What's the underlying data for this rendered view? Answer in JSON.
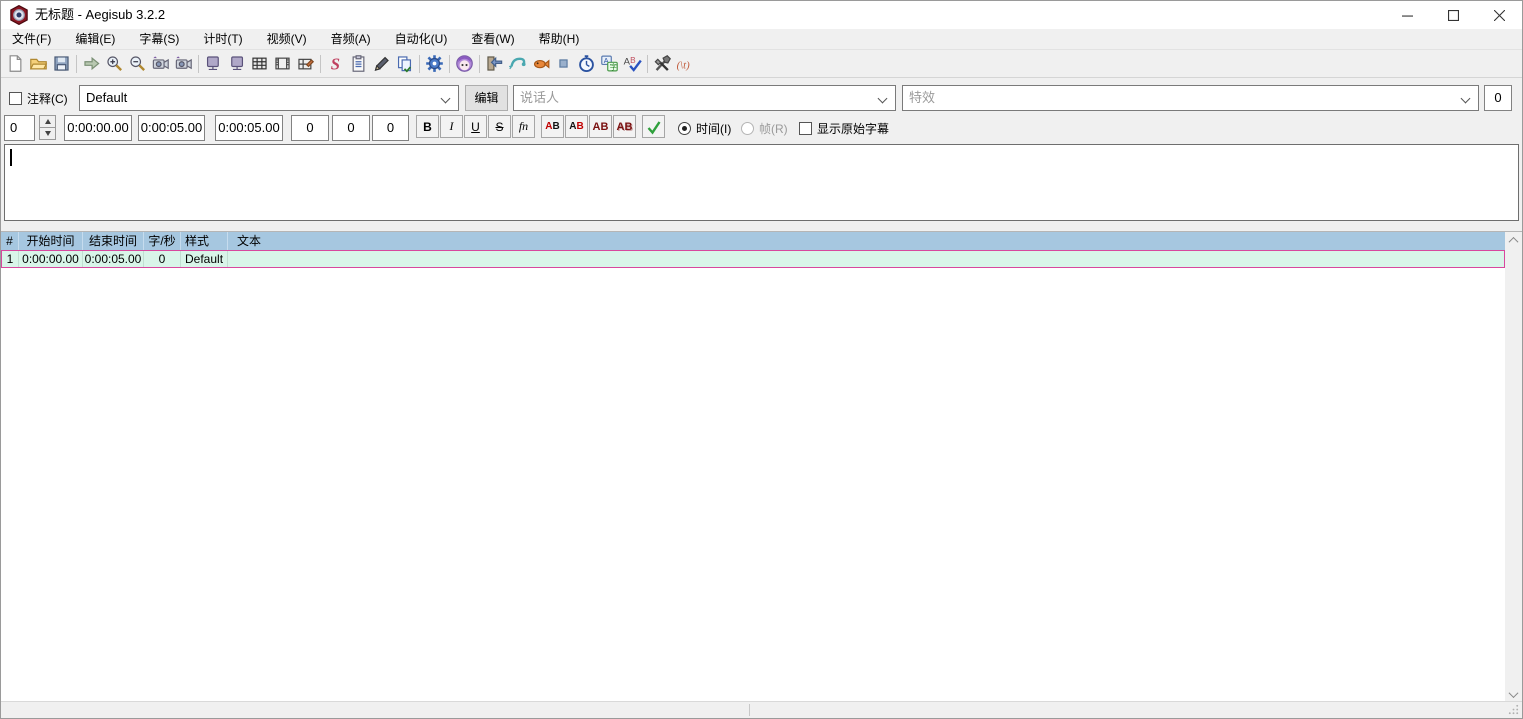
{
  "window": {
    "title": "无标题 - Aegisub 3.2.2"
  },
  "menu": {
    "items": [
      "文件(F)",
      "编辑(E)",
      "字幕(S)",
      "计时(T)",
      "视频(V)",
      "音频(A)",
      "自动化(U)",
      "查看(W)",
      "帮助(H)"
    ]
  },
  "toolbar": {
    "icons": [
      "new-file",
      "open-folder",
      "save",
      "|",
      "arrow-right",
      "magnifier-plus",
      "magnifier-minus",
      "camera-backward",
      "camera-forward",
      "|",
      "monitor-a",
      "monitor-b",
      "grid",
      "film-frame",
      "film-edit",
      "|",
      "styles-s",
      "properties-clipboard",
      "pencil",
      "copy-pages",
      "|",
      "gear",
      "|",
      "assistant-face",
      "|",
      "door-arrow",
      "shrimp",
      "fish",
      "small-square",
      "stopwatch",
      "kanji-translate",
      "spellcheck",
      "|",
      "hammer-wrench",
      "tag-t"
    ]
  },
  "edit": {
    "comment_label": "注释(C)",
    "style_value": "Default",
    "edit_button_label": "编辑",
    "actor_placeholder": "说话人",
    "effect_placeholder": "特效",
    "max_line_chars": "0",
    "layer_value": "0",
    "start_time": "0:00:00.00",
    "end_time": "0:00:05.00",
    "duration": "0:00:05.00",
    "margin_left": "0",
    "margin_right": "0",
    "margin_vertical": "0",
    "bold_label": "B",
    "italic_label": "I",
    "underline_label": "U",
    "strikeout_label": "S",
    "font_label": "fn",
    "color_a": "A",
    "color_b": "B",
    "time_radio_label": "时间(I)",
    "frame_radio_label": "帧(R)",
    "show_original_label": "显示原始字幕",
    "text_value": ""
  },
  "grid": {
    "columns": [
      "#",
      "开始时间",
      "结束时间",
      "字/秒",
      "样式",
      "文本"
    ],
    "rows": [
      {
        "num": "1",
        "start": "0:00:00.00",
        "end": "0:00:05.00",
        "cps": "0",
        "style": "Default",
        "text": ""
      }
    ]
  },
  "colors": {
    "grid_header_bg": "#a6c7e0",
    "active_row_bg": "#d9f5e9",
    "active_row_border": "#d8489e",
    "commit_check": "#2fa03c"
  }
}
